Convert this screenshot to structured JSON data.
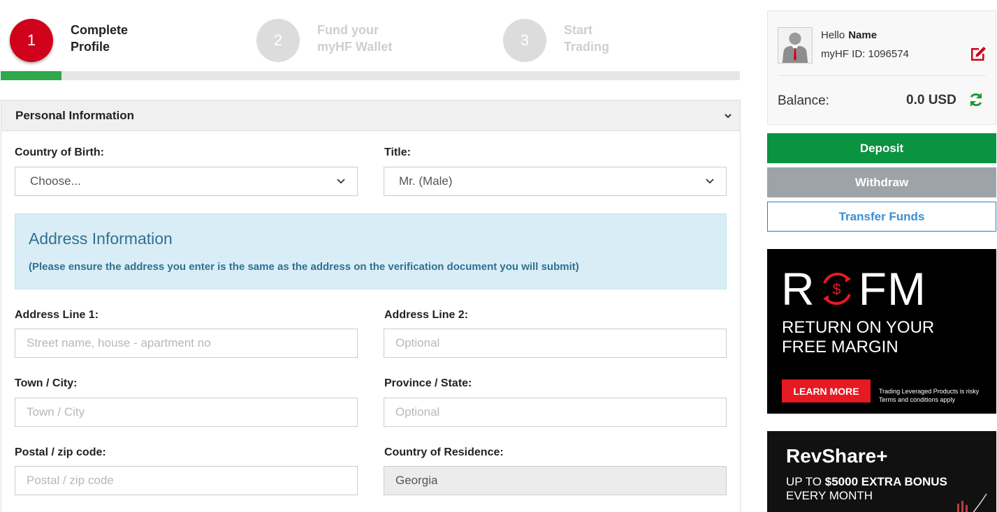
{
  "steps": [
    {
      "number": "1",
      "line1": "Complete",
      "line2": "Profile",
      "state": "active"
    },
    {
      "number": "2",
      "line1": "Fund your",
      "line2": "myHF Wallet",
      "state": "inactive"
    },
    {
      "number": "3",
      "line1": "Start",
      "line2": "Trading",
      "state": "inactive"
    }
  ],
  "progress": {
    "fraction": 0.082
  },
  "personal": {
    "title": "Personal Information",
    "country_of_birth_label": "Country of Birth:",
    "country_of_birth_value": "Choose...",
    "title_label": "Title:",
    "title_value": "Mr. (Male)"
  },
  "address": {
    "heading": "Address Information",
    "note": "(Please ensure the address you enter is the same as the address on the verification document you will submit)",
    "line1_label": "Address Line 1:",
    "line1_placeholder": "Street name, house - apartment no",
    "line2_label": "Address Line 2:",
    "line2_placeholder": "Optional",
    "city_label": "Town / City:",
    "city_placeholder": "Town / City",
    "province_label": "Province / State:",
    "province_placeholder": "Optional",
    "postal_label": "Postal / zip code:",
    "postal_placeholder": "Postal / zip code",
    "residence_label": "Country of Residence:",
    "residence_value": "Georgia"
  },
  "account": {
    "hello": "Hello",
    "name": "Name",
    "id_text": "myHF ID: 1096574",
    "balance_label": "Balance:",
    "balance_value": "0.0 USD",
    "icons": {
      "avatar": "user-avatar-icon",
      "edit": "edit-icon",
      "refresh": "refresh-icon"
    }
  },
  "actions": {
    "deposit": "Deposit",
    "withdraw": "Withdraw",
    "transfer": "Transfer Funds"
  },
  "banner_rofm": {
    "logo_left": "R",
    "logo_right": "FM",
    "line1": "RETURN ON YOUR",
    "line2": "FREE MARGIN",
    "cta": "LEARN MORE",
    "fine1": "Trading Leveraged Products is risky",
    "fine2": "Terms and conditions apply"
  },
  "banner_revshare": {
    "title": "RevShare+",
    "line1_prefix": "UP TO ",
    "line1_bold": "$5000 EXTRA BONUS",
    "line2": "EVERY MONTH"
  },
  "colors": {
    "brand_red": "#d0021b",
    "progress_green": "#2ea84a",
    "deposit_green": "#0a9340",
    "info_blue": "#31708f",
    "link_blue": "#3a8fd4"
  }
}
